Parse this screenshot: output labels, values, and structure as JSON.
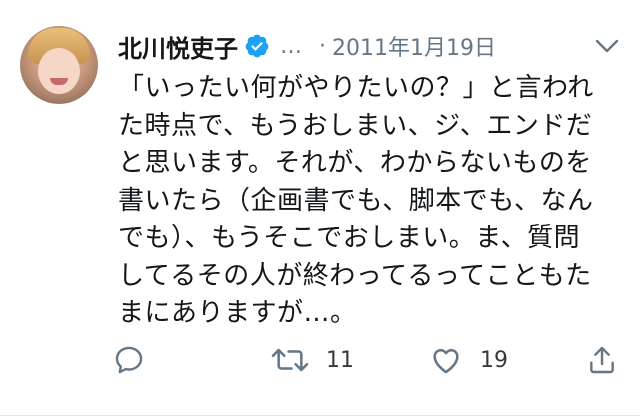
{
  "author": {
    "name": "北川悦吏子",
    "handle_ellipsis": "…",
    "date_separator": "·",
    "date": "2011年1月19日"
  },
  "tweet": {
    "lines": [
      "「いったい何がやりたいの？」と言われ",
      "た時点で、もうおしまい、ジ、エンドだ",
      "と思います。それが、わからないものを",
      "書いたら（企画書でも、脚本でも、なん",
      "でも）、もうそこでおしまい。ま、質問",
      "してるその人が終わってるってこともた",
      "まにありますが…。"
    ]
  },
  "actions": {
    "reply": {
      "icon": "reply-icon"
    },
    "retweet": {
      "icon": "retweet-icon",
      "count": "11"
    },
    "like": {
      "icon": "heart-icon",
      "count": "19"
    },
    "share": {
      "icon": "share-icon"
    }
  },
  "colors": {
    "verified_badge": "#1da1f2",
    "muted_text": "#657786",
    "primary_text": "#14171a"
  }
}
